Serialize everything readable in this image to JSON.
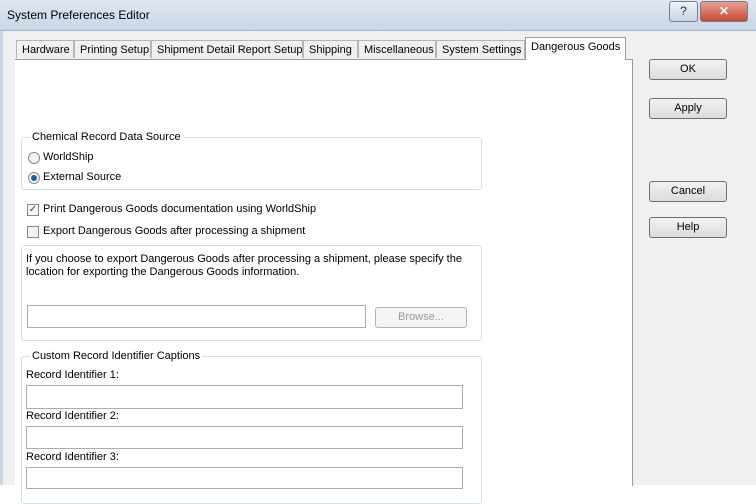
{
  "window": {
    "title": "System Preferences Editor",
    "help_glyph": "?",
    "close_glyph": "✕"
  },
  "tabs": [
    {
      "label": "Hardware"
    },
    {
      "label": "Printing Setup"
    },
    {
      "label": "Shipment Detail Report Setup"
    },
    {
      "label": "Shipping"
    },
    {
      "label": "Miscellaneous"
    },
    {
      "label": "System Settings"
    },
    {
      "label": "Dangerous Goods",
      "active": true
    }
  ],
  "chemical_group": {
    "title": "Chemical Record Data Source",
    "options": [
      {
        "label": "WorldShip",
        "selected": false
      },
      {
        "label": "External Source",
        "selected": true
      }
    ]
  },
  "print_dg": {
    "label": "Print Dangerous Goods documentation using WorldShip",
    "checked": true,
    "mark": "✓"
  },
  "export_dg": {
    "label": "Export Dangerous Goods after processing a shipment",
    "checked": false
  },
  "export_info": {
    "line1": "If you choose to export Dangerous Goods after processing a shipment, please specify the",
    "line2": "location for exporting the Dangerous Goods information.",
    "path_value": "",
    "browse_label": "Browse..."
  },
  "custom_captions": {
    "title": "Custom Record Identifier Captions",
    "fields": [
      {
        "label": "Record Identifier 1:",
        "value": ""
      },
      {
        "label": "Record Identifier 2:",
        "value": ""
      },
      {
        "label": "Record Identifier 3:",
        "value": ""
      }
    ]
  },
  "buttons": {
    "ok": "OK",
    "apply": "Apply",
    "cancel": "Cancel",
    "help": "Help"
  },
  "colors": {
    "title_bar": "#c9d6e6",
    "close": "#c74a32",
    "radio_dot": "#1c5ca8"
  }
}
